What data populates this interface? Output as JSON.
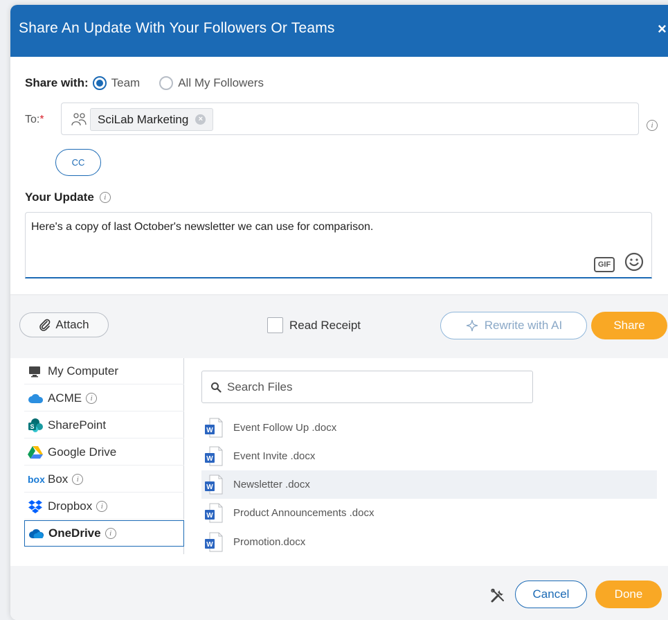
{
  "dialog": {
    "title": "Share An Update With Your Followers Or Teams",
    "close_label": "×"
  },
  "share_with": {
    "label": "Share with:",
    "options": [
      {
        "label": "Team",
        "selected": true
      },
      {
        "label": "All My Followers",
        "selected": false
      }
    ]
  },
  "to": {
    "label": "To:",
    "required_mark": "*",
    "recipients": [
      {
        "label": "SciLab Marketing"
      }
    ],
    "info_label": "i"
  },
  "cc": {
    "label": "CC"
  },
  "update": {
    "label": "Your Update",
    "info_label": "i",
    "text": "Here's a copy of last October's newsletter we can use for comparison.",
    "gif_label": "GIF"
  },
  "actions": {
    "attach_label": "Attach",
    "read_receipt_label": "Read Receipt",
    "rewrite_label": "Rewrite with AI",
    "share_label": "Share"
  },
  "sources": [
    {
      "label": "My Computer",
      "icon": "computer-icon",
      "info": false,
      "active": false
    },
    {
      "label": "ACME",
      "icon": "cloud-icon",
      "info": true,
      "active": false
    },
    {
      "label": "SharePoint",
      "icon": "sharepoint-icon",
      "info": false,
      "active": false
    },
    {
      "label": "Google Drive",
      "icon": "google-drive-icon",
      "info": false,
      "active": false
    },
    {
      "label": "Box",
      "icon": "box-icon",
      "info": true,
      "active": false
    },
    {
      "label": "Dropbox",
      "icon": "dropbox-icon",
      "info": true,
      "active": false
    },
    {
      "label": "OneDrive",
      "icon": "onedrive-icon",
      "info": true,
      "active": true
    }
  ],
  "box_logo_text": "box",
  "search": {
    "placeholder": "Search Files"
  },
  "files": [
    {
      "name": "Event Follow Up .docx",
      "selected": false
    },
    {
      "name": "Event Invite .docx",
      "selected": false
    },
    {
      "name": "Newsletter .docx",
      "selected": true
    },
    {
      "name": "Product Announcements .docx",
      "selected": false
    },
    {
      "name": "Promotion.docx",
      "selected": false
    }
  ],
  "word_icon_letter": "W",
  "footer": {
    "cancel_label": "Cancel",
    "done_label": "Done"
  },
  "colors": {
    "brand_blue": "#1b6ab5",
    "accent_orange": "#f9a825",
    "required_red": "#d9232e"
  }
}
